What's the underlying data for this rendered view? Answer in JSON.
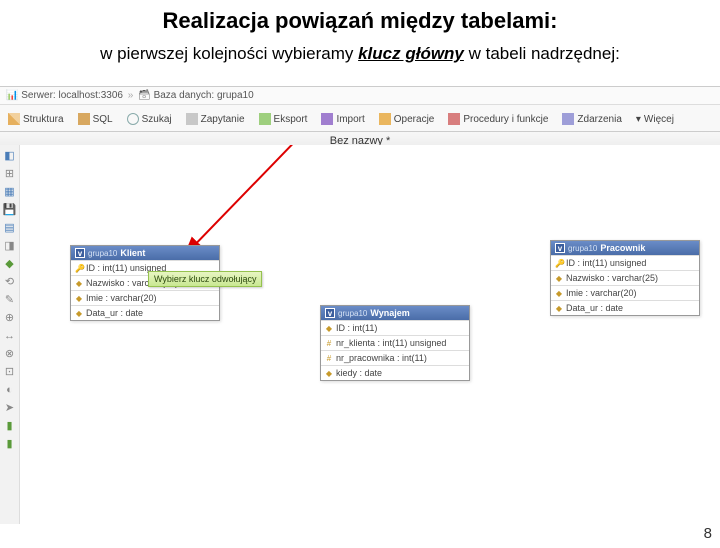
{
  "title": "Realizacja powiązań między tabelami:",
  "subtitle_pre": "w pierwszej kolejności wybieramy ",
  "subtitle_em": "klucz główny",
  "subtitle_post": " w tabeli nadrzędnej:",
  "page_number": "8",
  "breadcrumb": {
    "server_icon": "🖥",
    "server_label": "Serwer:",
    "server_value": "localhost:3306",
    "arrow": "»",
    "db_icon": "🗄",
    "db_label": "Baza danych:",
    "db_value": "grupa10"
  },
  "tabs": [
    {
      "label": "Struktura",
      "icon": "struct"
    },
    {
      "label": "SQL",
      "icon": "sql"
    },
    {
      "label": "Szukaj",
      "icon": "search"
    },
    {
      "label": "Zapytanie",
      "icon": "query"
    },
    {
      "label": "Eksport",
      "icon": "export"
    },
    {
      "label": "Import",
      "icon": "import"
    },
    {
      "label": "Operacje",
      "icon": "ops"
    },
    {
      "label": "Procedury i funkcje",
      "icon": "proc"
    },
    {
      "label": "Zdarzenia",
      "icon": "events"
    },
    {
      "label": "Więcej",
      "icon": "more"
    }
  ],
  "strip_title": "Bez nazwy *",
  "tooltip_text": "Wybierz klucz odwołujący",
  "tables": {
    "klient": {
      "db": "grupa10",
      "name": "Klient",
      "cols": [
        {
          "key": "🔑",
          "text": "ID : int(11) unsigned"
        },
        {
          "key": "◆",
          "text": "Nazwisko : varchar(25)"
        },
        {
          "key": "◆",
          "text": "Imie : varchar(20)"
        },
        {
          "key": "◆",
          "text": "Data_ur : date"
        }
      ]
    },
    "wynajem": {
      "db": "grupa10",
      "name": "Wynajem",
      "cols": [
        {
          "key": "◆",
          "text": "ID : int(11)"
        },
        {
          "key": "#",
          "text": "nr_klienta : int(11) unsigned"
        },
        {
          "key": "#",
          "text": "nr_pracownika : int(11)"
        },
        {
          "key": "◆",
          "text": "kiedy : date"
        }
      ]
    },
    "pracownik": {
      "db": "grupa10",
      "name": "Pracownik",
      "cols": [
        {
          "key": "🔑",
          "text": "ID : int(11) unsigned"
        },
        {
          "key": "◆",
          "text": "Nazwisko : varchar(25)"
        },
        {
          "key": "◆",
          "text": "Imie : varchar(20)"
        },
        {
          "key": "◆",
          "text": "Data_ur : date"
        }
      ]
    }
  }
}
